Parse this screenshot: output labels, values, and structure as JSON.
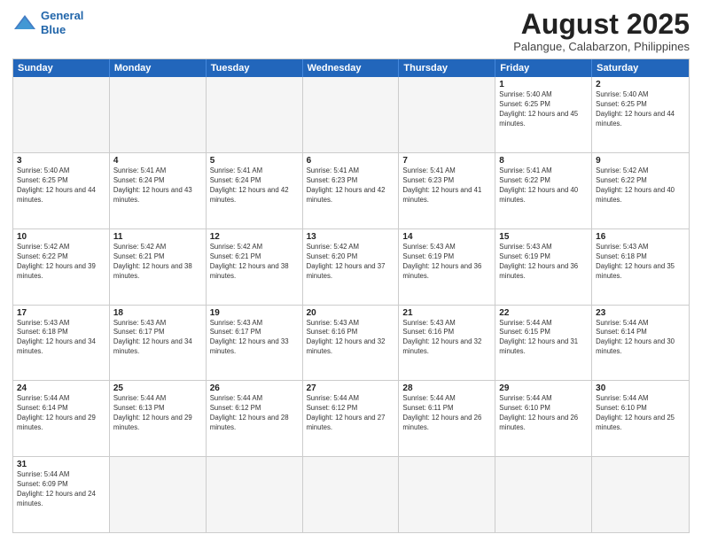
{
  "header": {
    "logo_line1": "General",
    "logo_line2": "Blue",
    "month_title": "August 2025",
    "subtitle": "Palangue, Calabarzon, Philippines"
  },
  "weekdays": [
    "Sunday",
    "Monday",
    "Tuesday",
    "Wednesday",
    "Thursday",
    "Friday",
    "Saturday"
  ],
  "weeks": [
    [
      {
        "day": "",
        "empty": true
      },
      {
        "day": "",
        "empty": true
      },
      {
        "day": "",
        "empty": true
      },
      {
        "day": "",
        "empty": true
      },
      {
        "day": "",
        "empty": true
      },
      {
        "day": "1",
        "sunrise": "5:40 AM",
        "sunset": "6:25 PM",
        "daylight": "12 hours and 45 minutes."
      },
      {
        "day": "2",
        "sunrise": "5:40 AM",
        "sunset": "6:25 PM",
        "daylight": "12 hours and 44 minutes."
      }
    ],
    [
      {
        "day": "3",
        "sunrise": "5:40 AM",
        "sunset": "6:25 PM",
        "daylight": "12 hours and 44 minutes."
      },
      {
        "day": "4",
        "sunrise": "5:41 AM",
        "sunset": "6:24 PM",
        "daylight": "12 hours and 43 minutes."
      },
      {
        "day": "5",
        "sunrise": "5:41 AM",
        "sunset": "6:24 PM",
        "daylight": "12 hours and 42 minutes."
      },
      {
        "day": "6",
        "sunrise": "5:41 AM",
        "sunset": "6:23 PM",
        "daylight": "12 hours and 42 minutes."
      },
      {
        "day": "7",
        "sunrise": "5:41 AM",
        "sunset": "6:23 PM",
        "daylight": "12 hours and 41 minutes."
      },
      {
        "day": "8",
        "sunrise": "5:41 AM",
        "sunset": "6:22 PM",
        "daylight": "12 hours and 40 minutes."
      },
      {
        "day": "9",
        "sunrise": "5:42 AM",
        "sunset": "6:22 PM",
        "daylight": "12 hours and 40 minutes."
      }
    ],
    [
      {
        "day": "10",
        "sunrise": "5:42 AM",
        "sunset": "6:22 PM",
        "daylight": "12 hours and 39 minutes."
      },
      {
        "day": "11",
        "sunrise": "5:42 AM",
        "sunset": "6:21 PM",
        "daylight": "12 hours and 38 minutes."
      },
      {
        "day": "12",
        "sunrise": "5:42 AM",
        "sunset": "6:21 PM",
        "daylight": "12 hours and 38 minutes."
      },
      {
        "day": "13",
        "sunrise": "5:42 AM",
        "sunset": "6:20 PM",
        "daylight": "12 hours and 37 minutes."
      },
      {
        "day": "14",
        "sunrise": "5:43 AM",
        "sunset": "6:19 PM",
        "daylight": "12 hours and 36 minutes."
      },
      {
        "day": "15",
        "sunrise": "5:43 AM",
        "sunset": "6:19 PM",
        "daylight": "12 hours and 36 minutes."
      },
      {
        "day": "16",
        "sunrise": "5:43 AM",
        "sunset": "6:18 PM",
        "daylight": "12 hours and 35 minutes."
      }
    ],
    [
      {
        "day": "17",
        "sunrise": "5:43 AM",
        "sunset": "6:18 PM",
        "daylight": "12 hours and 34 minutes."
      },
      {
        "day": "18",
        "sunrise": "5:43 AM",
        "sunset": "6:17 PM",
        "daylight": "12 hours and 34 minutes."
      },
      {
        "day": "19",
        "sunrise": "5:43 AM",
        "sunset": "6:17 PM",
        "daylight": "12 hours and 33 minutes."
      },
      {
        "day": "20",
        "sunrise": "5:43 AM",
        "sunset": "6:16 PM",
        "daylight": "12 hours and 32 minutes."
      },
      {
        "day": "21",
        "sunrise": "5:43 AM",
        "sunset": "6:16 PM",
        "daylight": "12 hours and 32 minutes."
      },
      {
        "day": "22",
        "sunrise": "5:44 AM",
        "sunset": "6:15 PM",
        "daylight": "12 hours and 31 minutes."
      },
      {
        "day": "23",
        "sunrise": "5:44 AM",
        "sunset": "6:14 PM",
        "daylight": "12 hours and 30 minutes."
      }
    ],
    [
      {
        "day": "24",
        "sunrise": "5:44 AM",
        "sunset": "6:14 PM",
        "daylight": "12 hours and 29 minutes."
      },
      {
        "day": "25",
        "sunrise": "5:44 AM",
        "sunset": "6:13 PM",
        "daylight": "12 hours and 29 minutes."
      },
      {
        "day": "26",
        "sunrise": "5:44 AM",
        "sunset": "6:12 PM",
        "daylight": "12 hours and 28 minutes."
      },
      {
        "day": "27",
        "sunrise": "5:44 AM",
        "sunset": "6:12 PM",
        "daylight": "12 hours and 27 minutes."
      },
      {
        "day": "28",
        "sunrise": "5:44 AM",
        "sunset": "6:11 PM",
        "daylight": "12 hours and 26 minutes."
      },
      {
        "day": "29",
        "sunrise": "5:44 AM",
        "sunset": "6:10 PM",
        "daylight": "12 hours and 26 minutes."
      },
      {
        "day": "30",
        "sunrise": "5:44 AM",
        "sunset": "6:10 PM",
        "daylight": "12 hours and 25 minutes."
      }
    ],
    [
      {
        "day": "31",
        "sunrise": "5:44 AM",
        "sunset": "6:09 PM",
        "daylight": "12 hours and 24 minutes."
      },
      {
        "day": "",
        "empty": true
      },
      {
        "day": "",
        "empty": true
      },
      {
        "day": "",
        "empty": true
      },
      {
        "day": "",
        "empty": true
      },
      {
        "day": "",
        "empty": true
      },
      {
        "day": "",
        "empty": true
      }
    ]
  ]
}
